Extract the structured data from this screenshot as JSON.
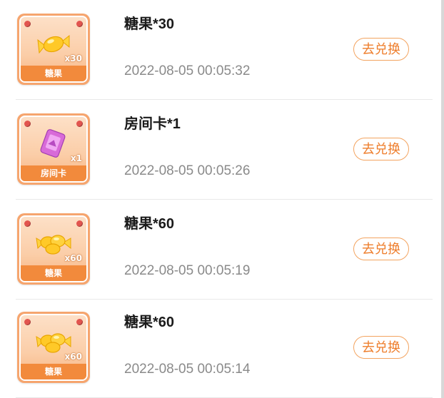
{
  "items": [
    {
      "title": "糖果*30",
      "time": "2022-08-05 00:05:32",
      "button": "去兑换",
      "thumb_label": "糖果",
      "thumb_qty": "x30",
      "icon": "candy-icon"
    },
    {
      "title": "房间卡*1",
      "time": "2022-08-05 00:05:26",
      "button": "去兑换",
      "thumb_label": "房间卡",
      "thumb_qty": "x1",
      "icon": "room-card-icon"
    },
    {
      "title": "糖果*60",
      "time": "2022-08-05 00:05:19",
      "button": "去兑换",
      "thumb_label": "糖果",
      "thumb_qty": "x60",
      "icon": "candy-icon"
    },
    {
      "title": "糖果*60",
      "time": "2022-08-05 00:05:14",
      "button": "去兑换",
      "thumb_label": "糖果",
      "thumb_qty": "x60",
      "icon": "candy-icon"
    }
  ],
  "colors": {
    "accent": "#ee7d2b",
    "thumb_frame": "#f6a56e",
    "thumb_label_bg": "#f28a3c",
    "time_text": "#8a8a8a"
  }
}
